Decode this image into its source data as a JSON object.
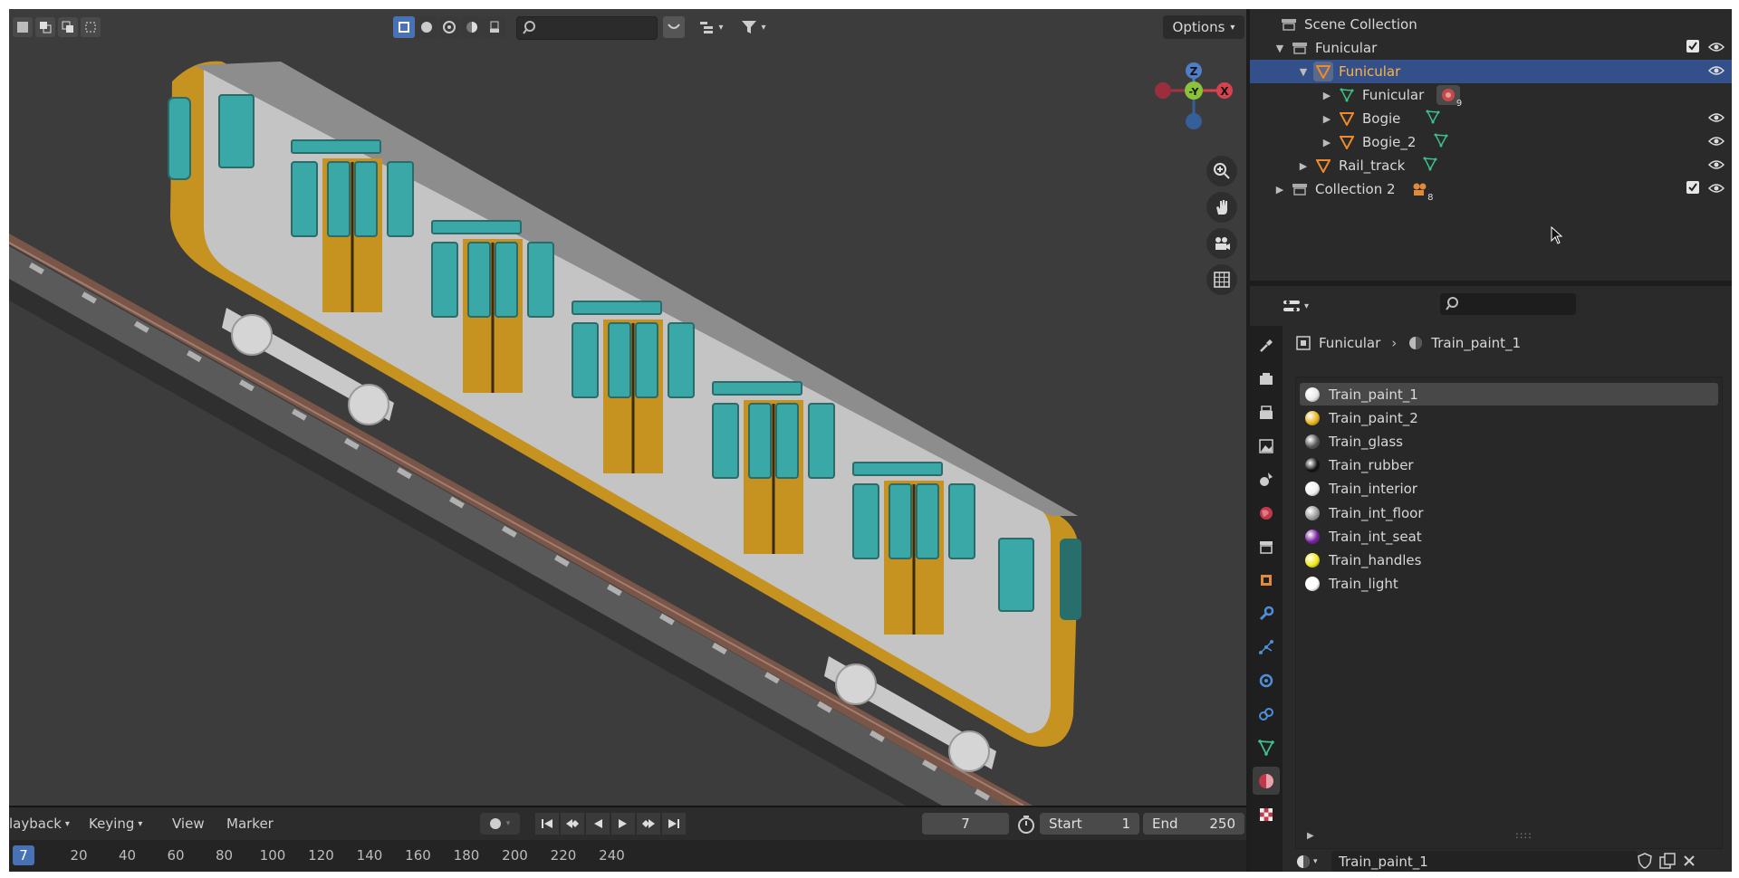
{
  "viewport": {
    "options_label": "Options"
  },
  "gizmo": {
    "z": "Z",
    "y": "-Y",
    "x": "X"
  },
  "timeline": {
    "menus": [
      "layback",
      "Keying",
      "View",
      "Marker"
    ],
    "current_frame": "7",
    "start_label": "Start",
    "start_value": "1",
    "end_label": "End",
    "end_value": "250",
    "ruler_current": "7",
    "ruler_ticks": [
      "20",
      "40",
      "60",
      "80",
      "100",
      "120",
      "140",
      "160",
      "180",
      "200",
      "220",
      "240"
    ]
  },
  "outliner": {
    "rows": [
      {
        "label": "Scene Collection"
      },
      {
        "label": "Funicular"
      },
      {
        "label": "Funicular"
      },
      {
        "label": "Funicular",
        "badge": "9"
      },
      {
        "label": "Bogie"
      },
      {
        "label": "Bogie_2"
      },
      {
        "label": "Rail_track"
      },
      {
        "label": "Collection 2",
        "badge": "8"
      }
    ]
  },
  "properties": {
    "breadcrumb_object": "Funicular",
    "breadcrumb_material": "Train_paint_1",
    "materials": [
      {
        "name": "Train_paint_1",
        "color": "#e8e8e8"
      },
      {
        "name": "Train_paint_2",
        "color": "#e7b41a"
      },
      {
        "name": "Train_glass",
        "color": "#555555"
      },
      {
        "name": "Train_rubber",
        "color": "#111111"
      },
      {
        "name": "Train_interior",
        "color": "#f0f0f0"
      },
      {
        "name": "Train_int_floor",
        "color": "#9a9a9a"
      },
      {
        "name": "Train_int_seat",
        "color": "#7a1fa0"
      },
      {
        "name": "Train_handles",
        "color": "#f3ea14"
      },
      {
        "name": "Train_light",
        "color": "#ffffff"
      }
    ],
    "slot_material": "Train_paint_1"
  }
}
